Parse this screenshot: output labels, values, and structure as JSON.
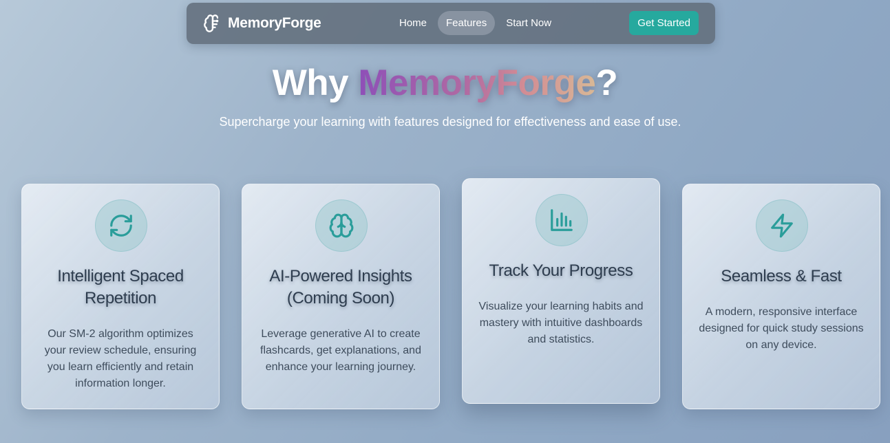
{
  "nav": {
    "brand": "MemoryForge",
    "brand_icon": "brain-icon",
    "links": [
      {
        "label": "Home",
        "active": false
      },
      {
        "label": "Features",
        "active": true
      },
      {
        "label": "Start Now",
        "active": false
      }
    ],
    "cta_label": "Get Started"
  },
  "hero": {
    "title_prefix": "Why ",
    "title_brand": "MemoryForge",
    "title_suffix": "?",
    "subtitle": "Supercharge your learning with features designed for effectiveness and ease of use."
  },
  "features": [
    {
      "icon": "refresh-icon",
      "title": "Intelligent Spaced Repetition",
      "description": "Our SM-2 algorithm optimizes your review schedule, ensuring you learn efficiently and retain information longer."
    },
    {
      "icon": "brain-icon",
      "title": "AI-Powered Insights (Coming Soon)",
      "description": "Leverage generative AI to create flashcards, get explanations, and enhance your learning journey."
    },
    {
      "icon": "bar-chart-icon",
      "title": "Track Your Progress",
      "description": "Visualize your learning habits and mastery with intuitive dashboards and statistics."
    },
    {
      "icon": "lightning-bolt-icon",
      "title": "Seamless & Fast",
      "description": "A modern, responsive interface designed for quick study sessions on any device."
    }
  ],
  "colors": {
    "accent": "#26a99e",
    "icon_teal": "#2a9d9a",
    "card_title": "#2e3d4f",
    "body_text": "#3e4c5c",
    "nav_bg": "#626e7c"
  }
}
